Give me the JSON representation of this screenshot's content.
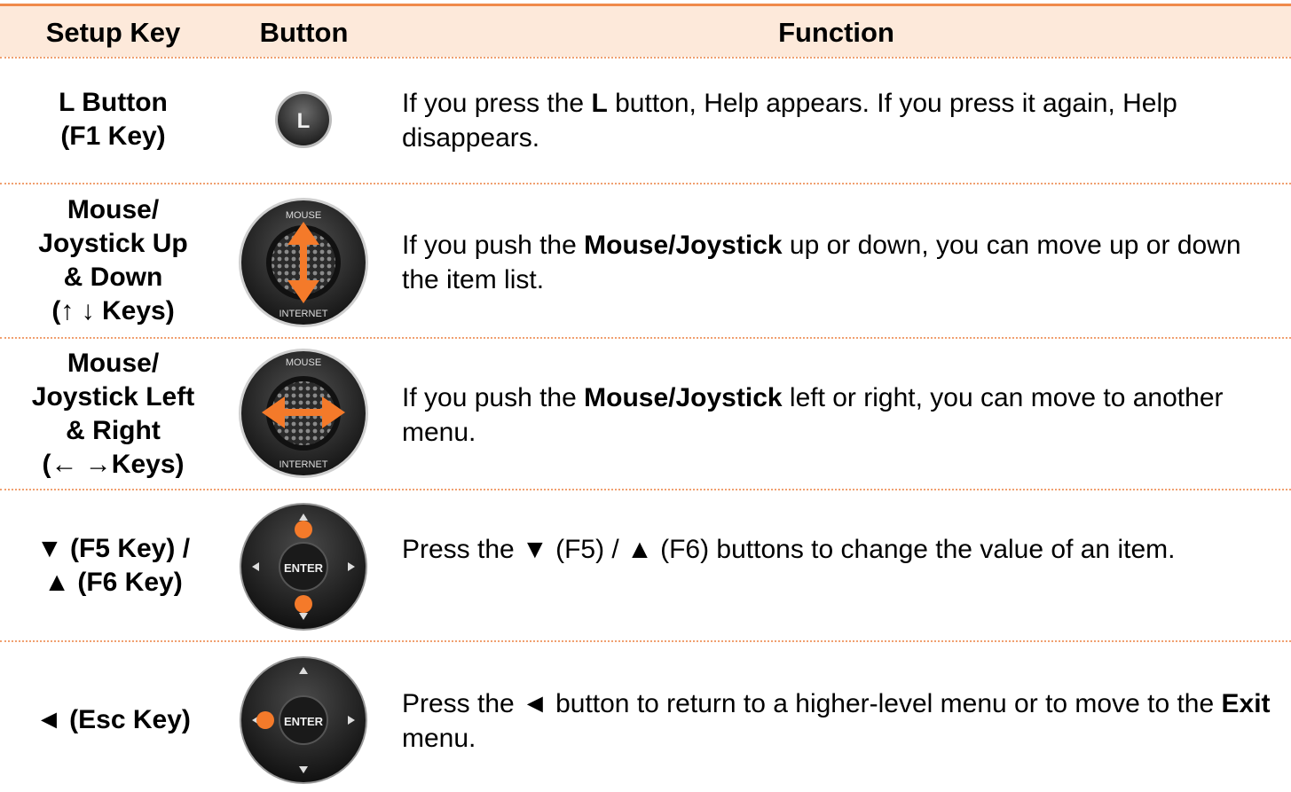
{
  "header": {
    "setup_key": "Setup Key",
    "button": "Button",
    "function": "Function"
  },
  "rows": [
    {
      "key_lines": [
        "L Button",
        "(F1 Key)"
      ],
      "button_icon": "l-button-icon",
      "button_label": "L",
      "function_parts": [
        "If you press the ",
        "L",
        " button, Help appears. If you press it again, Help disappears."
      ]
    },
    {
      "key_lines": [
        "Mouse/",
        "Joystick Up",
        "& Down",
        "(↑ ↓ Keys)"
      ],
      "button_icon": "joystick-up-down-icon",
      "joystick_top": "MOUSE",
      "joystick_bottom": "INTERNET",
      "function_parts": [
        "If you push the ",
        "Mouse/Joystick",
        " up or down, you can move up or down the item list."
      ]
    },
    {
      "key_lines": [
        "Mouse/",
        "Joystick Left",
        "& Right",
        "(← →Keys)"
      ],
      "button_icon": "joystick-left-right-icon",
      "joystick_top": "MOUSE",
      "joystick_bottom": "INTERNET",
      "function_parts": [
        "If you push the ",
        "Mouse/Joystick",
        " left or right, you can move to another menu."
      ]
    },
    {
      "key_lines": [
        "▼ (F5 Key) /",
        "▲ (F6 Key)"
      ],
      "button_icon": "dpad-up-down-icon",
      "dpad_label": "ENTER",
      "function_parts": [
        "Press the ▼ (F5) / ▲ (F6) buttons to change the value of an item."
      ]
    },
    {
      "key_lines": [
        "◄ (Esc Key)"
      ],
      "button_icon": "dpad-left-icon",
      "dpad_label": "ENTER",
      "function_parts": [
        "Press the ◄ button to return to a higher-level menu or to move to the ",
        "Exit",
        " menu."
      ]
    }
  ],
  "colors": {
    "accent": "#f08a4b",
    "header_bg": "#fde9da",
    "highlight": "#f47a2a"
  }
}
